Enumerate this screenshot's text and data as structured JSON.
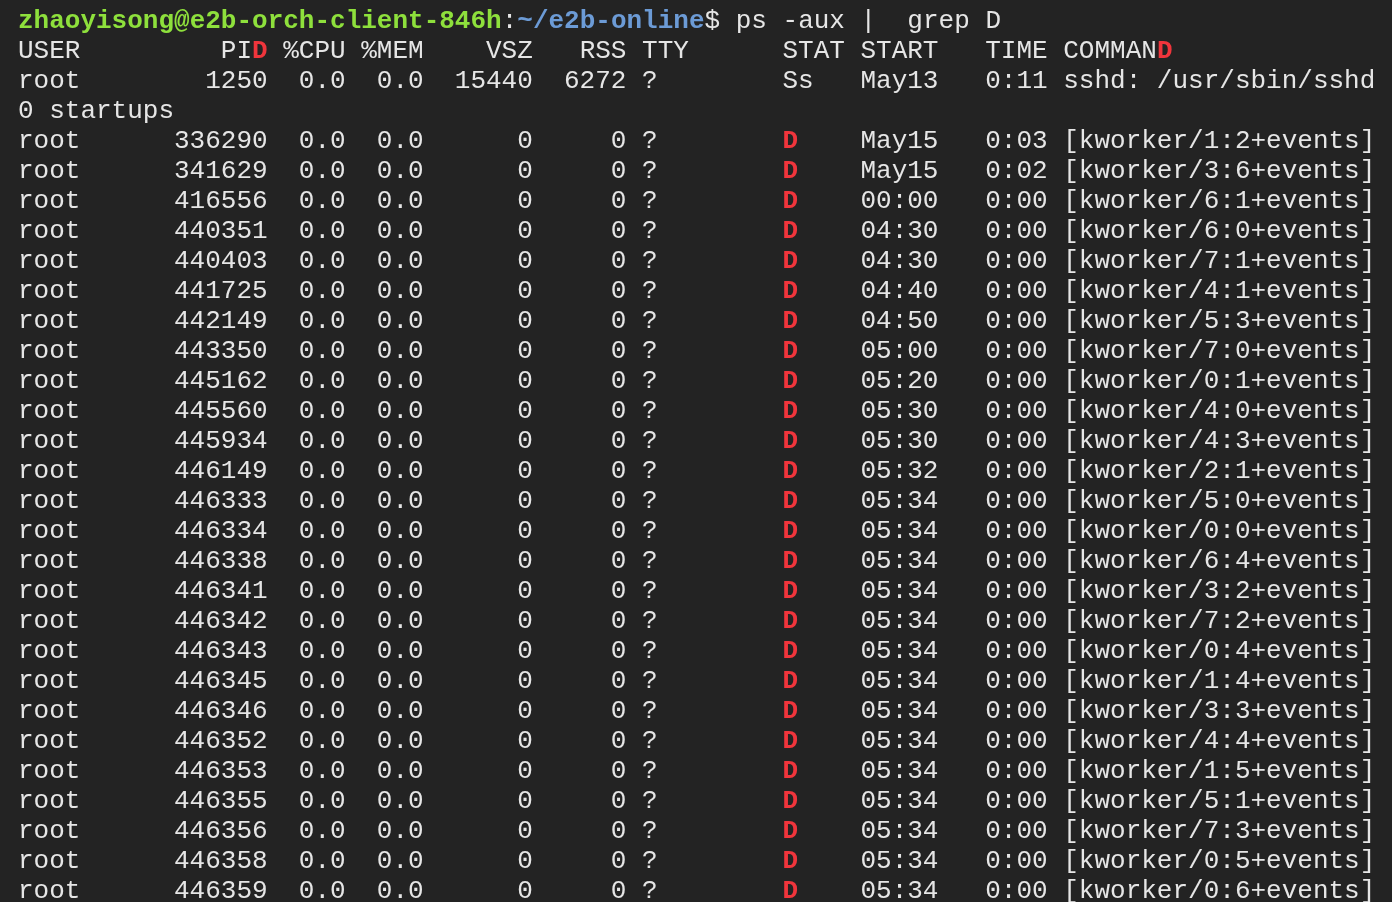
{
  "prompt": {
    "user_host": "zhaoyisong@e2b-orch-client-846h",
    "separator": ":",
    "path": "~/e2b-online",
    "command": "$ ps -aux |  grep D"
  },
  "columns": [
    {
      "label": "USER"
    },
    {
      "label": "PI",
      "match": "D"
    },
    {
      "label": "%CPU"
    },
    {
      "label": "%MEM"
    },
    {
      "label": "VSZ"
    },
    {
      "label": "RSS"
    },
    {
      "label": "TTY"
    },
    {
      "label": "STAT"
    },
    {
      "label": "START"
    },
    {
      "label": "TIME"
    },
    {
      "label": "COMMAN",
      "match": "D"
    }
  ],
  "rows": [
    {
      "cells": [
        "root",
        "1250",
        "0.0",
        "0.0",
        "15440",
        "6272",
        "?",
        "Ss",
        "May13",
        "0:11",
        "sshd: /usr/sbin/sshd"
      ],
      "stat_match": false,
      "continuation": "0 startups"
    },
    {
      "cells": [
        "root",
        "336290",
        "0.0",
        "0.0",
        "0",
        "0",
        "?",
        "D",
        "May15",
        "0:03",
        "[kworker/1:2+events]"
      ],
      "stat_match": true
    },
    {
      "cells": [
        "root",
        "341629",
        "0.0",
        "0.0",
        "0",
        "0",
        "?",
        "D",
        "May15",
        "0:02",
        "[kworker/3:6+events]"
      ],
      "stat_match": true
    },
    {
      "cells": [
        "root",
        "416556",
        "0.0",
        "0.0",
        "0",
        "0",
        "?",
        "D",
        "00:00",
        "0:00",
        "[kworker/6:1+events]"
      ],
      "stat_match": true
    },
    {
      "cells": [
        "root",
        "440351",
        "0.0",
        "0.0",
        "0",
        "0",
        "?",
        "D",
        "04:30",
        "0:00",
        "[kworker/6:0+events]"
      ],
      "stat_match": true
    },
    {
      "cells": [
        "root",
        "440403",
        "0.0",
        "0.0",
        "0",
        "0",
        "?",
        "D",
        "04:30",
        "0:00",
        "[kworker/7:1+events]"
      ],
      "stat_match": true
    },
    {
      "cells": [
        "root",
        "441725",
        "0.0",
        "0.0",
        "0",
        "0",
        "?",
        "D",
        "04:40",
        "0:00",
        "[kworker/4:1+events]"
      ],
      "stat_match": true
    },
    {
      "cells": [
        "root",
        "442149",
        "0.0",
        "0.0",
        "0",
        "0",
        "?",
        "D",
        "04:50",
        "0:00",
        "[kworker/5:3+events]"
      ],
      "stat_match": true
    },
    {
      "cells": [
        "root",
        "443350",
        "0.0",
        "0.0",
        "0",
        "0",
        "?",
        "D",
        "05:00",
        "0:00",
        "[kworker/7:0+events]"
      ],
      "stat_match": true
    },
    {
      "cells": [
        "root",
        "445162",
        "0.0",
        "0.0",
        "0",
        "0",
        "?",
        "D",
        "05:20",
        "0:00",
        "[kworker/0:1+events]"
      ],
      "stat_match": true
    },
    {
      "cells": [
        "root",
        "445560",
        "0.0",
        "0.0",
        "0",
        "0",
        "?",
        "D",
        "05:30",
        "0:00",
        "[kworker/4:0+events]"
      ],
      "stat_match": true
    },
    {
      "cells": [
        "root",
        "445934",
        "0.0",
        "0.0",
        "0",
        "0",
        "?",
        "D",
        "05:30",
        "0:00",
        "[kworker/4:3+events]"
      ],
      "stat_match": true
    },
    {
      "cells": [
        "root",
        "446149",
        "0.0",
        "0.0",
        "0",
        "0",
        "?",
        "D",
        "05:32",
        "0:00",
        "[kworker/2:1+events]"
      ],
      "stat_match": true
    },
    {
      "cells": [
        "root",
        "446333",
        "0.0",
        "0.0",
        "0",
        "0",
        "?",
        "D",
        "05:34",
        "0:00",
        "[kworker/5:0+events]"
      ],
      "stat_match": true
    },
    {
      "cells": [
        "root",
        "446334",
        "0.0",
        "0.0",
        "0",
        "0",
        "?",
        "D",
        "05:34",
        "0:00",
        "[kworker/0:0+events]"
      ],
      "stat_match": true
    },
    {
      "cells": [
        "root",
        "446338",
        "0.0",
        "0.0",
        "0",
        "0",
        "?",
        "D",
        "05:34",
        "0:00",
        "[kworker/6:4+events]"
      ],
      "stat_match": true
    },
    {
      "cells": [
        "root",
        "446341",
        "0.0",
        "0.0",
        "0",
        "0",
        "?",
        "D",
        "05:34",
        "0:00",
        "[kworker/3:2+events]"
      ],
      "stat_match": true
    },
    {
      "cells": [
        "root",
        "446342",
        "0.0",
        "0.0",
        "0",
        "0",
        "?",
        "D",
        "05:34",
        "0:00",
        "[kworker/7:2+events]"
      ],
      "stat_match": true
    },
    {
      "cells": [
        "root",
        "446343",
        "0.0",
        "0.0",
        "0",
        "0",
        "?",
        "D",
        "05:34",
        "0:00",
        "[kworker/0:4+events]"
      ],
      "stat_match": true
    },
    {
      "cells": [
        "root",
        "446345",
        "0.0",
        "0.0",
        "0",
        "0",
        "?",
        "D",
        "05:34",
        "0:00",
        "[kworker/1:4+events]"
      ],
      "stat_match": true
    },
    {
      "cells": [
        "root",
        "446346",
        "0.0",
        "0.0",
        "0",
        "0",
        "?",
        "D",
        "05:34",
        "0:00",
        "[kworker/3:3+events]"
      ],
      "stat_match": true
    },
    {
      "cells": [
        "root",
        "446352",
        "0.0",
        "0.0",
        "0",
        "0",
        "?",
        "D",
        "05:34",
        "0:00",
        "[kworker/4:4+events]"
      ],
      "stat_match": true
    },
    {
      "cells": [
        "root",
        "446353",
        "0.0",
        "0.0",
        "0",
        "0",
        "?",
        "D",
        "05:34",
        "0:00",
        "[kworker/1:5+events]"
      ],
      "stat_match": true
    },
    {
      "cells": [
        "root",
        "446355",
        "0.0",
        "0.0",
        "0",
        "0",
        "?",
        "D",
        "05:34",
        "0:00",
        "[kworker/5:1+events]"
      ],
      "stat_match": true
    },
    {
      "cells": [
        "root",
        "446356",
        "0.0",
        "0.0",
        "0",
        "0",
        "?",
        "D",
        "05:34",
        "0:00",
        "[kworker/7:3+events]"
      ],
      "stat_match": true
    },
    {
      "cells": [
        "root",
        "446358",
        "0.0",
        "0.0",
        "0",
        "0",
        "?",
        "D",
        "05:34",
        "0:00",
        "[kworker/0:5+events]"
      ],
      "stat_match": true
    },
    {
      "cells": [
        "root",
        "446359",
        "0.0",
        "0.0",
        "0",
        "0",
        "?",
        "D",
        "05:34",
        "0:00",
        "[kworker/0:6+events]"
      ],
      "stat_match": true
    }
  ]
}
